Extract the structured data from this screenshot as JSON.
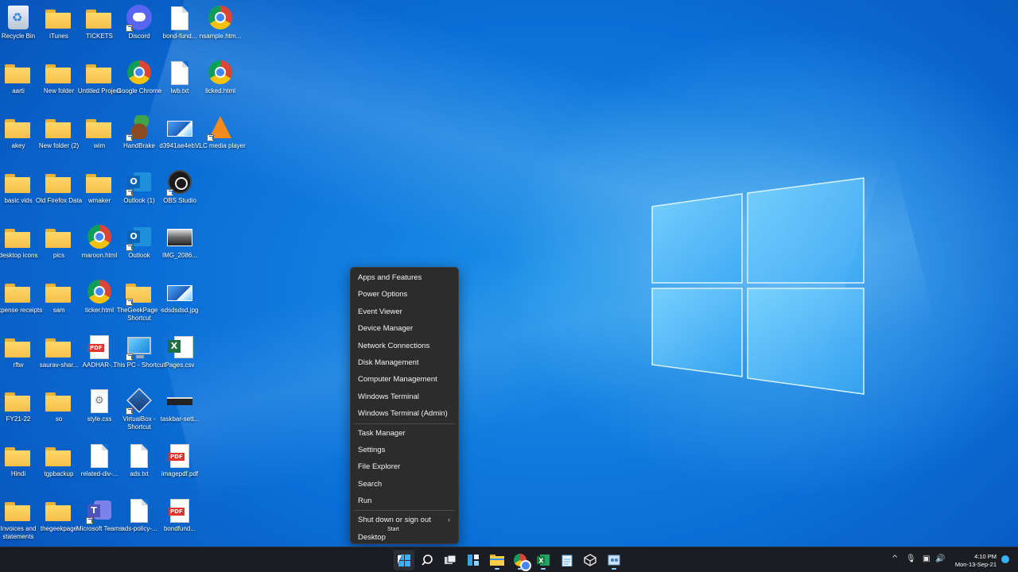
{
  "desktop": {
    "icons": [
      {
        "label": "Recycle Bin",
        "icon": "recycle-bin-icon"
      },
      {
        "label": "iTunes",
        "icon": "folder-icon"
      },
      {
        "label": "TICKETS",
        "icon": "folder-icon"
      },
      {
        "label": "Discord",
        "icon": "discord-icon"
      },
      {
        "label": "bond-fund...",
        "icon": "document-icon"
      },
      {
        "label": "nsample.htm...",
        "icon": "chrome-icon"
      },
      {
        "label": "aarti",
        "icon": "folder-icon"
      },
      {
        "label": "New folder",
        "icon": "folder-icon"
      },
      {
        "label": "Untitled Project",
        "icon": "folder-icon"
      },
      {
        "label": "Google Chrome",
        "icon": "chrome-icon"
      },
      {
        "label": "lwb.txt",
        "icon": "document-icon"
      },
      {
        "label": "licked.html",
        "icon": "chrome-icon"
      },
      {
        "label": "akey",
        "icon": "folder-icon"
      },
      {
        "label": "New folder (2)",
        "icon": "folder-icon"
      },
      {
        "label": "wim",
        "icon": "folder-icon"
      },
      {
        "label": "HandBrake",
        "icon": "handbrake-icon"
      },
      {
        "label": "d3941ae4eb...",
        "icon": "image-icon"
      },
      {
        "label": "VLC media player",
        "icon": "vlc-icon"
      },
      {
        "label": "basic vids",
        "icon": "folder-icon"
      },
      {
        "label": "Old Firefox Data",
        "icon": "folder-icon"
      },
      {
        "label": "wmaker",
        "icon": "folder-icon"
      },
      {
        "label": "Outlook (1)",
        "icon": "outlook-icon"
      },
      {
        "label": "OBS Studio",
        "icon": "obs-icon"
      },
      {
        "label": "",
        "icon": "none"
      },
      {
        "label": "desktop icons",
        "icon": "folder-icon"
      },
      {
        "label": "pics",
        "icon": "folder-icon"
      },
      {
        "label": "maroon.html",
        "icon": "chrome-icon"
      },
      {
        "label": "Outlook",
        "icon": "outlook-icon"
      },
      {
        "label": "IMG_2086...",
        "icon": "image-dark-icon"
      },
      {
        "label": "",
        "icon": "none"
      },
      {
        "label": "expense receipts",
        "icon": "folder-icon"
      },
      {
        "label": "sam",
        "icon": "folder-icon"
      },
      {
        "label": "ticker.html",
        "icon": "chrome-icon"
      },
      {
        "label": "TheGeekPage - Shortcut",
        "icon": "folder-icon"
      },
      {
        "label": "sdsdsdsd.jpg",
        "icon": "image-icon"
      },
      {
        "label": "",
        "icon": "none"
      },
      {
        "label": "rftw",
        "icon": "folder-icon"
      },
      {
        "label": "saurav-shar...",
        "icon": "folder-icon"
      },
      {
        "label": "AADHAR-...",
        "icon": "pdf-icon"
      },
      {
        "label": "This PC - Shortcut",
        "icon": "monitor-icon"
      },
      {
        "label": "Pages.csv",
        "icon": "excel-icon"
      },
      {
        "label": "",
        "icon": "none"
      },
      {
        "label": "FY21-22",
        "icon": "folder-icon"
      },
      {
        "label": "so",
        "icon": "folder-icon"
      },
      {
        "label": "style.css",
        "icon": "gear-document-icon"
      },
      {
        "label": "VirtualBox - Shortcut",
        "icon": "virtualbox-icon"
      },
      {
        "label": "taskbar-sett...",
        "icon": "dark-strip-icon"
      },
      {
        "label": "",
        "icon": "none"
      },
      {
        "label": "Hindi",
        "icon": "folder-icon"
      },
      {
        "label": "tgpbackup",
        "icon": "folder-icon"
      },
      {
        "label": "related-div-...",
        "icon": "document-icon"
      },
      {
        "label": "ads.txt",
        "icon": "document-icon"
      },
      {
        "label": "imagepdf.pdf",
        "icon": "pdf-icon"
      },
      {
        "label": "",
        "icon": "none"
      },
      {
        "label": "Invoices and statements",
        "icon": "folder-icon"
      },
      {
        "label": "thegeekpage",
        "icon": "folder-icon"
      },
      {
        "label": "Microsoft Teams",
        "icon": "teams-icon"
      },
      {
        "label": "ads-policy-...",
        "icon": "document-icon"
      },
      {
        "label": "bondfund...",
        "icon": "pdf-icon"
      },
      {
        "label": "",
        "icon": "none"
      }
    ]
  },
  "context_menu": {
    "items": [
      {
        "label": "Apps and Features"
      },
      {
        "label": "Power Options"
      },
      {
        "label": "Event Viewer"
      },
      {
        "label": "Device Manager"
      },
      {
        "label": "Network Connections"
      },
      {
        "label": "Disk Management"
      },
      {
        "label": "Computer Management"
      },
      {
        "label": "Windows Terminal"
      },
      {
        "label": "Windows Terminal (Admin)"
      },
      {
        "label": "Task Manager"
      },
      {
        "label": "Settings"
      },
      {
        "label": "File Explorer"
      },
      {
        "label": "Search"
      },
      {
        "label": "Run"
      },
      {
        "label": "Shut down or sign out"
      },
      {
        "label": "Desktop"
      }
    ],
    "submenu_arrow": "›"
  },
  "tooltip": {
    "text": "Start"
  },
  "taskbar": {
    "apps": [
      "start-icon",
      "search-icon",
      "task-view-icon",
      "widgets-icon",
      "file-explorer-icon",
      "chrome-icon",
      "excel-icon",
      "notepad-icon",
      "virtualbox-icon",
      "snipping-icon"
    ],
    "tray": {
      "chevron": "^",
      "time": "4:10 PM",
      "date": "Mon-13-Sep-21"
    }
  },
  "colors": {
    "menu_bg": "#2c2c2c",
    "taskbar_bg": "#1b1d22",
    "accent": "#3ab0ff"
  }
}
